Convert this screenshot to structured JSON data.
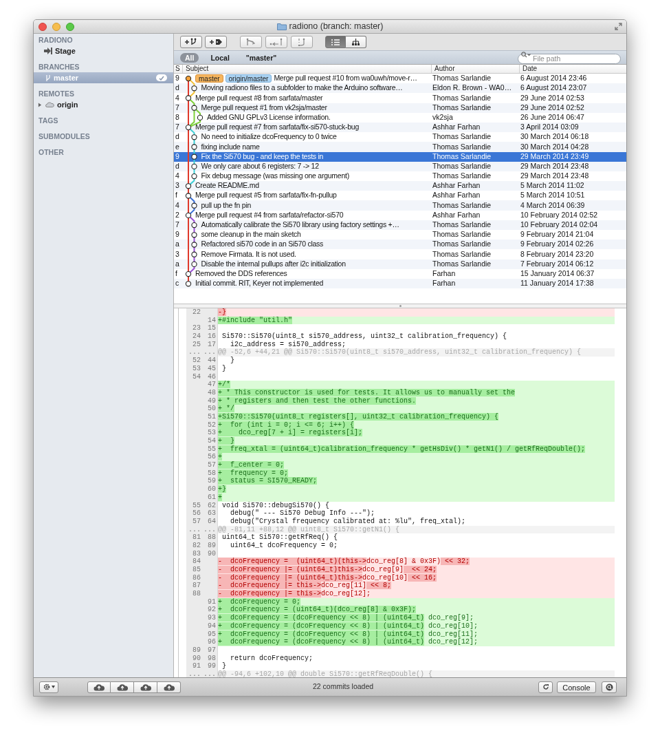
{
  "window": {
    "title": "radiono (branch: master)"
  },
  "sidebar": {
    "sections": [
      {
        "title": "RADIONO",
        "items": [
          {
            "label": "Stage",
            "kind": "stage",
            "selected": false
          }
        ]
      },
      {
        "title": "BRANCHES",
        "items": [
          {
            "label": "master",
            "kind": "branch",
            "selected": true,
            "checked": true
          }
        ]
      },
      {
        "title": "REMOTES",
        "items": [
          {
            "label": "origin",
            "kind": "remote",
            "selected": false,
            "expanded": false
          }
        ]
      },
      {
        "title": "TAGS"
      },
      {
        "title": "SUBMODULES"
      },
      {
        "title": "OTHER"
      }
    ]
  },
  "view_modes": [
    {
      "kind": "list",
      "selected": true
    },
    {
      "kind": "tree",
      "selected": false
    }
  ],
  "filters": [
    {
      "label": "All",
      "selected": true
    },
    {
      "label": "Local",
      "selected": false
    },
    {
      "label": "\"master\"",
      "selected": false
    }
  ],
  "search": {
    "placeholder": "File path"
  },
  "commit_list": {
    "columns": [
      "S",
      "Subject",
      "Author",
      "Date"
    ],
    "rows": [
      {
        "sha": "9",
        "refs": [
          {
            "name": "master",
            "kind": "local"
          },
          {
            "name": "origin/master",
            "kind": "remote"
          }
        ],
        "subject": "Merge pull request #10 from wa0uwh/move-r…",
        "author": "Thomas Sarlandie",
        "date": "6 August 2014 23:46",
        "selected": false
      },
      {
        "sha": "d",
        "subject": "Moving radiono files to a subfolder to make the Arduino software…",
        "author": "Eldon R. Brown - WA0…",
        "date": "6 August 2014 23:07",
        "selected": false
      },
      {
        "sha": "4",
        "subject": "Merge pull request #8 from sarfata/master",
        "author": "Thomas Sarlandie",
        "date": "29 June 2014 02:53",
        "selected": false
      },
      {
        "sha": "7",
        "subject": "Merge pull request #1 from vk2sja/master",
        "author": "Thomas Sarlandie",
        "date": "29 June 2014 02:52",
        "selected": false
      },
      {
        "sha": "8",
        "subject": "Added GNU GPLv3 License information.",
        "author": "vk2sja",
        "date": "26 June 2014 06:47",
        "selected": false
      },
      {
        "sha": "7",
        "subject": "Merge pull request #7 from sarfata/fix-si570-stuck-bug",
        "author": "Ashhar Farhan",
        "date": "3 April 2014 03:09",
        "selected": false
      },
      {
        "sha": "d",
        "subject": "No need to initialize dcoFrequency to 0 twice",
        "author": "Thomas Sarlandie",
        "date": "30 March 2014 06:18",
        "selected": false
      },
      {
        "sha": "e",
        "subject": "fixing include name",
        "author": "Thomas Sarlandie",
        "date": "30 March 2014 04:28",
        "selected": false
      },
      {
        "sha": "9",
        "subject": "Fix the Si570 bug - and keep the tests in",
        "author": "Thomas Sarlandie",
        "date": "29 March 2014 23:49",
        "selected": true
      },
      {
        "sha": "d",
        "subject": "We only care about 6 registers: 7 -> 12",
        "author": "Thomas Sarlandie",
        "date": "29 March 2014 23:48",
        "selected": false
      },
      {
        "sha": "4",
        "subject": "Fix debug message (was missing one argument)",
        "author": "Thomas Sarlandie",
        "date": "29 March 2014 23:48",
        "selected": false
      },
      {
        "sha": "3",
        "subject": "Create README.md",
        "author": "Ashhar Farhan",
        "date": "5 March 2014 11:02",
        "selected": false
      },
      {
        "sha": "f",
        "subject": "Merge pull request #5 from sarfata/fix-fn-pullup",
        "author": "Ashhar Farhan",
        "date": "5 March 2014 10:51",
        "selected": false
      },
      {
        "sha": "4",
        "subject": "pull up the fn pin",
        "author": "Thomas Sarlandie",
        "date": "4 March 2014 06:39",
        "selected": false
      },
      {
        "sha": "2",
        "subject": "Merge pull request #4 from sarfata/refactor-si570",
        "author": "Ashhar Farhan",
        "date": "10 February 2014 02:52",
        "selected": false
      },
      {
        "sha": "7",
        "subject": "Automatically calibrate the Si570 library using factory settings +…",
        "author": "Thomas Sarlandie",
        "date": "10 February 2014 02:04",
        "selected": false
      },
      {
        "sha": "9",
        "subject": "some cleanup in the main sketch",
        "author": "Thomas Sarlandie",
        "date": "9 February 2014 21:04",
        "selected": false
      },
      {
        "sha": "a",
        "subject": "Refactored si570 code in an Si570 class",
        "author": "Thomas Sarlandie",
        "date": "9 February 2014 02:26",
        "selected": false
      },
      {
        "sha": "3",
        "subject": "Remove Firmata. It is not used.",
        "author": "Thomas Sarlandie",
        "date": "8 February 2014 23:20",
        "selected": false
      },
      {
        "sha": "a",
        "subject": "Disable the internal pullups after i2c initialization",
        "author": "Thomas Sarlandie",
        "date": "7 February 2014 06:12",
        "selected": false
      },
      {
        "sha": "f",
        "subject": "Removed the DDS references",
        "author": "Farhan",
        "date": "15 January 2014 06:37",
        "selected": false
      },
      {
        "sha": "c",
        "subject": "Initial commit. RIT, Keyer not implemented",
        "author": "Farhan",
        "date": "11 January 2014 17:38",
        "selected": false
      }
    ]
  },
  "diff": {
    "lines": [
      {
        "kind": "del",
        "old": "22",
        "segments": [
          {
            "text": "-}",
            "changed": true
          }
        ]
      },
      {
        "kind": "add",
        "new": "14",
        "segments": [
          {
            "text": "+#include \"util.h\"",
            "changed": true
          }
        ]
      },
      {
        "kind": "context",
        "old": "23",
        "new": "15"
      },
      {
        "kind": "context",
        "old": "24",
        "new": "16",
        "text": " Si570::Si570(uint8_t si570_address, uint32_t calibration_frequency) {"
      },
      {
        "kind": "context",
        "old": "25",
        "new": "17",
        "text": "   i2c_address = si570_address;"
      },
      {
        "kind": "hunk",
        "old": "...",
        "new": "...",
        "text": "@@ -52,6 +44,21 @@ Si570::Si570(uint8_t si570_address, uint32_t calibration_frequency) {"
      },
      {
        "kind": "context",
        "old": "52",
        "new": "44",
        "text": "   }"
      },
      {
        "kind": "context",
        "old": "53",
        "new": "45",
        "text": " }"
      },
      {
        "kind": "context",
        "old": "54",
        "new": "46"
      },
      {
        "kind": "add",
        "new": "47",
        "segments": [
          {
            "text": "+/*",
            "changed": true
          }
        ]
      },
      {
        "kind": "add",
        "new": "48",
        "segments": [
          {
            "text": "+ * This constructor is used for tests. It allows us to manually set the",
            "changed": true
          }
        ]
      },
      {
        "kind": "add",
        "new": "49",
        "segments": [
          {
            "text": "+ * registers and then test the other functions.",
            "changed": true
          }
        ]
      },
      {
        "kind": "add",
        "new": "50",
        "segments": [
          {
            "text": "+ */",
            "changed": true
          }
        ]
      },
      {
        "kind": "add",
        "new": "51",
        "segments": [
          {
            "text": "+Si570::Si570(uint8_t registers[], uint32_t calibration_frequency) {",
            "changed": true
          }
        ]
      },
      {
        "kind": "add",
        "new": "52",
        "segments": [
          {
            "text": "+  for (int i = 0; i <= 6; i++) {",
            "changed": true
          }
        ]
      },
      {
        "kind": "add",
        "new": "53",
        "segments": [
          {
            "text": "+    dco_reg[7 + i] = registers[i];",
            "changed": true
          }
        ]
      },
      {
        "kind": "add",
        "new": "54",
        "segments": [
          {
            "text": "+  }",
            "changed": true
          }
        ]
      },
      {
        "kind": "add",
        "new": "55",
        "segments": [
          {
            "text": "+  freq_xtal = (uint64_t)calibration_frequency * getHsDiv() * getN1() / getRfReqDouble();",
            "changed": true
          }
        ]
      },
      {
        "kind": "add",
        "new": "56",
        "segments": [
          {
            "text": "+",
            "changed": true
          }
        ]
      },
      {
        "kind": "add",
        "new": "57",
        "segments": [
          {
            "text": "+  f_center = 0;",
            "changed": true
          }
        ]
      },
      {
        "kind": "add",
        "new": "58",
        "segments": [
          {
            "text": "+  frequency = 0;",
            "changed": true
          }
        ]
      },
      {
        "kind": "add",
        "new": "59",
        "segments": [
          {
            "text": "+  status = SI570_READY;",
            "changed": true
          }
        ]
      },
      {
        "kind": "add",
        "new": "60",
        "segments": [
          {
            "text": "+}",
            "changed": true
          }
        ]
      },
      {
        "kind": "add",
        "new": "61",
        "segments": [
          {
            "text": "+",
            "changed": true
          }
        ]
      },
      {
        "kind": "context",
        "old": "55",
        "new": "62",
        "text": " void Si570::debugSi570() {"
      },
      {
        "kind": "context",
        "old": "56",
        "new": "63",
        "text": "   debug(\" --- Si570 Debug Info ---\");"
      },
      {
        "kind": "context",
        "old": "57",
        "new": "64",
        "text": "   debug(\"Crystal frequency calibrated at: %lu\", freq_xtal);"
      },
      {
        "kind": "hunk",
        "old": "...",
        "new": "...",
        "text": "@@ -81,11 +88,12 @@ uint8_t Si570::getN1() {"
      },
      {
        "kind": "context",
        "old": "81",
        "new": "88",
        "text": " uint64_t Si570::getRfReq() {"
      },
      {
        "kind": "context",
        "old": "82",
        "new": "89",
        "text": "   uint64_t dcoFrequency = 0;"
      },
      {
        "kind": "context",
        "old": "83",
        "new": "90"
      },
      {
        "kind": "del",
        "old": "84",
        "segments": [
          {
            "text": "-  dcoFrequency =  (uint64_t)(this->",
            "changed": true
          },
          {
            "text": "dco_reg[8] & 0x3F)",
            "changed": false
          },
          {
            "text": " << 32;",
            "changed": true
          }
        ]
      },
      {
        "kind": "del",
        "old": "85",
        "segments": [
          {
            "text": "-  dcoFrequency |= (uint64_t)this->",
            "changed": true
          },
          {
            "text": "dco_reg[9]",
            "changed": false
          },
          {
            "text": "  << 24;",
            "changed": true
          }
        ]
      },
      {
        "kind": "del",
        "old": "86",
        "segments": [
          {
            "text": "-  dcoFrequency |= (uint64_t)this->",
            "changed": true
          },
          {
            "text": "dco_reg[10]",
            "changed": false
          },
          {
            "text": " << 16;",
            "changed": true
          }
        ]
      },
      {
        "kind": "del",
        "old": "87",
        "segments": [
          {
            "text": "-  dcoFrequency |= this->",
            "changed": true
          },
          {
            "text": "dco_reg[11]",
            "changed": false
          },
          {
            "text": " << 8;",
            "changed": true
          }
        ]
      },
      {
        "kind": "del",
        "old": "88",
        "segments": [
          {
            "text": "-  dcoFrequency |= this->",
            "changed": true
          },
          {
            "text": "dco_reg[12];",
            "changed": false
          }
        ]
      },
      {
        "kind": "add",
        "new": "91",
        "segments": [
          {
            "text": "+  dcoFrequency = 0;",
            "changed": true
          }
        ]
      },
      {
        "kind": "add",
        "new": "92",
        "segments": [
          {
            "text": "+  dcoFrequency = (uint64_t)(dco_reg[8] & 0x3F);",
            "changed": true
          }
        ]
      },
      {
        "kind": "add",
        "new": "93",
        "segments": [
          {
            "text": "+  dcoFrequency = (dcoFrequency << 8) | (uint64_t)",
            "changed": true
          },
          {
            "text": " dco_reg[9];",
            "changed": false
          }
        ]
      },
      {
        "kind": "add",
        "new": "94",
        "segments": [
          {
            "text": "+  dcoFrequency = (dcoFrequency << 8) | (uint64_t)",
            "changed": true
          },
          {
            "text": " dco_reg[10];",
            "changed": false
          }
        ]
      },
      {
        "kind": "add",
        "new": "95",
        "segments": [
          {
            "text": "+  dcoFrequency = (dcoFrequency << 8) | (uint64_t)",
            "changed": true
          },
          {
            "text": " dco_reg[11];",
            "changed": false
          }
        ]
      },
      {
        "kind": "add",
        "new": "96",
        "segments": [
          {
            "text": "+  dcoFrequency = (dcoFrequency << 8) | (uint64_t)",
            "changed": true
          },
          {
            "text": " dco_reg[12];",
            "changed": false
          }
        ]
      },
      {
        "kind": "context",
        "old": "89",
        "new": "97"
      },
      {
        "kind": "context",
        "old": "90",
        "new": "98",
        "text": "   return dcoFrequency;"
      },
      {
        "kind": "context",
        "old": "91",
        "new": "99",
        "text": " }"
      },
      {
        "kind": "hunk",
        "old": "...",
        "new": "...",
        "text": "@@ -94,6 +102,10 @@ double Si570::getRfReqDouble() {"
      }
    ]
  },
  "status_bar": {
    "text": "22 commits loaded",
    "console_button": "Console"
  }
}
